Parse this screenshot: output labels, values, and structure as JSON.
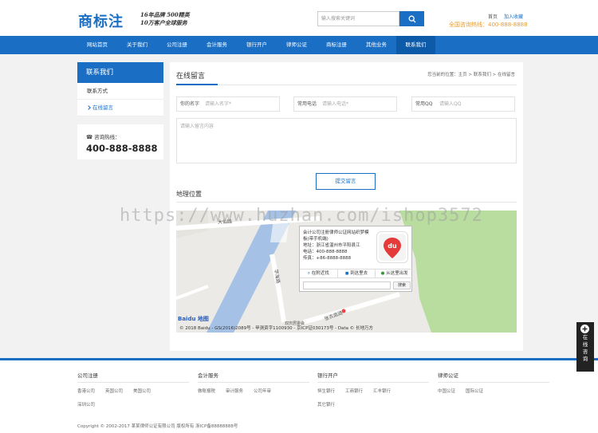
{
  "header": {
    "logo": "商标注",
    "slogan_line1": "16年品牌 500精英",
    "slogan_line2": "10万客户全球服务",
    "search_placeholder": "输入搜索关键词",
    "link_home": "首页",
    "link_favorite": "加入收藏",
    "hotline": "全国咨询热线：400-888-8888"
  },
  "nav": {
    "items": [
      "网站首页",
      "关于我们",
      "公司注册",
      "会计服务",
      "银行开户",
      "律师公证",
      "商标注册",
      "其他业务",
      "联系我们"
    ],
    "active_index": 8
  },
  "sidebar": {
    "title": "联系我们",
    "items": [
      "联系方式",
      "在线留言"
    ],
    "active_index": 1,
    "contact_label": "咨询热线：",
    "contact_number": "400-888-8888"
  },
  "main": {
    "title": "在线留言",
    "breadcrumb": "您当前的位置：主页 > 联系我们 > 在线留言",
    "name_label": "你的名字",
    "name_placeholder": "请输入名字*",
    "phone_label": "常用电话",
    "phone_placeholder": "请输入电话*",
    "qq_label": "常用QQ",
    "qq_placeholder": "请输入QQ",
    "content_placeholder": "请输入留言内容",
    "submit_label": "提交留言",
    "map_title": "地理位置"
  },
  "map": {
    "popup_line1": "会计公司注册律师公证网站织梦模",
    "popup_line2": "板(带手机端)",
    "popup_address": "地址：浙江省温州市平阳县江",
    "popup_phone": "电话：400-888-8888",
    "popup_fax": "传真：+86-8888-8888",
    "tab_nearby": "在附近找",
    "tab_to": "到这里去",
    "tab_from": "从这里出发",
    "search_button": "搜索",
    "road_1": "大仙路",
    "road_2": "学海路",
    "road_3": "张衣南路",
    "place_1": "双庆居委会",
    "baidu_logo": "Baidu 地图",
    "copyright": "© 2018 Baidu - GS(2016)2089号 - 甲测资字1100930 - 京ICP证030173号 - Data © 长地万方"
  },
  "watermark": "https://www.huzhan.com/ishop3572",
  "footer": {
    "columns": [
      {
        "title": "公司注册",
        "links": [
          "香港公司",
          "英国公司",
          "美国公司",
          "深圳公司"
        ]
      },
      {
        "title": "会计服务",
        "links": [
          "做账报税",
          "审计服务",
          "公司年审"
        ]
      },
      {
        "title": "银行开户",
        "links": [
          "恒生银行",
          "工商银行",
          "汇丰银行",
          "其它银行"
        ]
      },
      {
        "title": "律师公证",
        "links": [
          "中国公证",
          "国际公证"
        ]
      }
    ],
    "copyright": "Copyright © 2002-2017 某某律师公证有限公司 版权所有 浙ICP备88888888号"
  },
  "float_consult": "在线咨询",
  "colors": {
    "brand": "#1a6fc4",
    "hotline": "#e89a2c"
  }
}
